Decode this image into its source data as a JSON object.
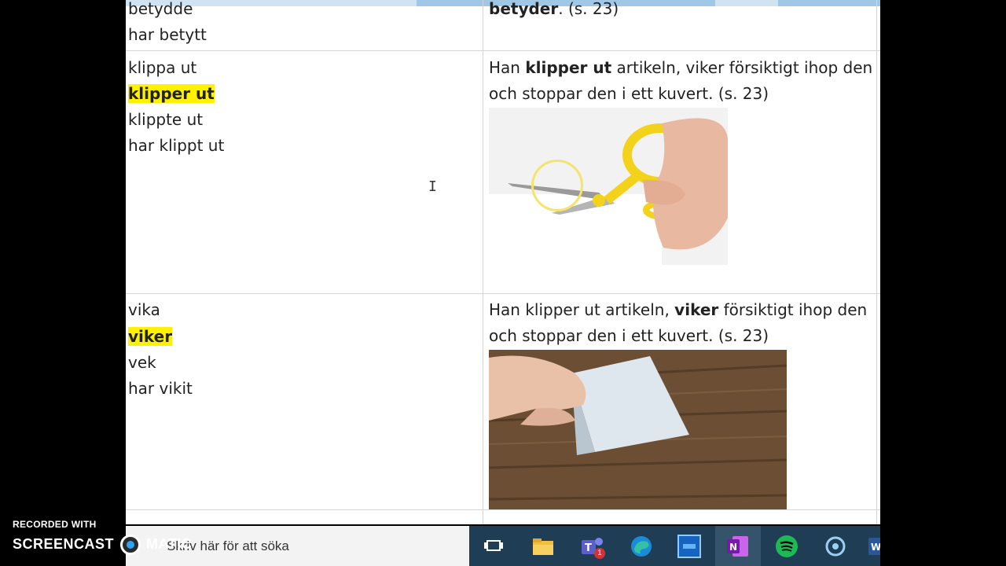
{
  "rows": [
    {
      "forms": [
        "betydde",
        "har betytt"
      ],
      "example_end": "betyder",
      "example_tail": ". (s. 23)"
    },
    {
      "forms": [
        "klippa ut",
        "klipper ut",
        "klippte ut",
        "har klippt ut"
      ],
      "example": {
        "before": "Han ",
        "bold": "klipper ut",
        "after": " artikeln, viker försiktigt ihop den och stoppar den i ett kuvert. (s. 23)"
      },
      "image_label": "scissors-cutting-paper"
    },
    {
      "forms": [
        "vika",
        "viker",
        "vek",
        "har vikit"
      ],
      "example": {
        "before": "Han klipper ut artikeln, ",
        "bold": "viker",
        "after": " försiktigt ihop den och stoppar den i ett kuvert. (s. 23)"
      },
      "image_label": "folding-paper"
    }
  ],
  "taskbar": {
    "search_placeholder": "Skriv här för att söka",
    "teams_badge": "1",
    "apps": [
      "task-view-icon",
      "file-explorer-icon",
      "teams-icon",
      "edge-icon",
      "app-icon",
      "onenote-icon",
      "spotify-icon",
      "cortana-icon",
      "word-icon"
    ]
  },
  "watermark": {
    "line1": "RECORDED WITH",
    "line2a": "SCREENCAST",
    "line2b": "MATIC"
  },
  "colors": {
    "highlight": "#fff200",
    "taskbar": "#1f3e56"
  }
}
